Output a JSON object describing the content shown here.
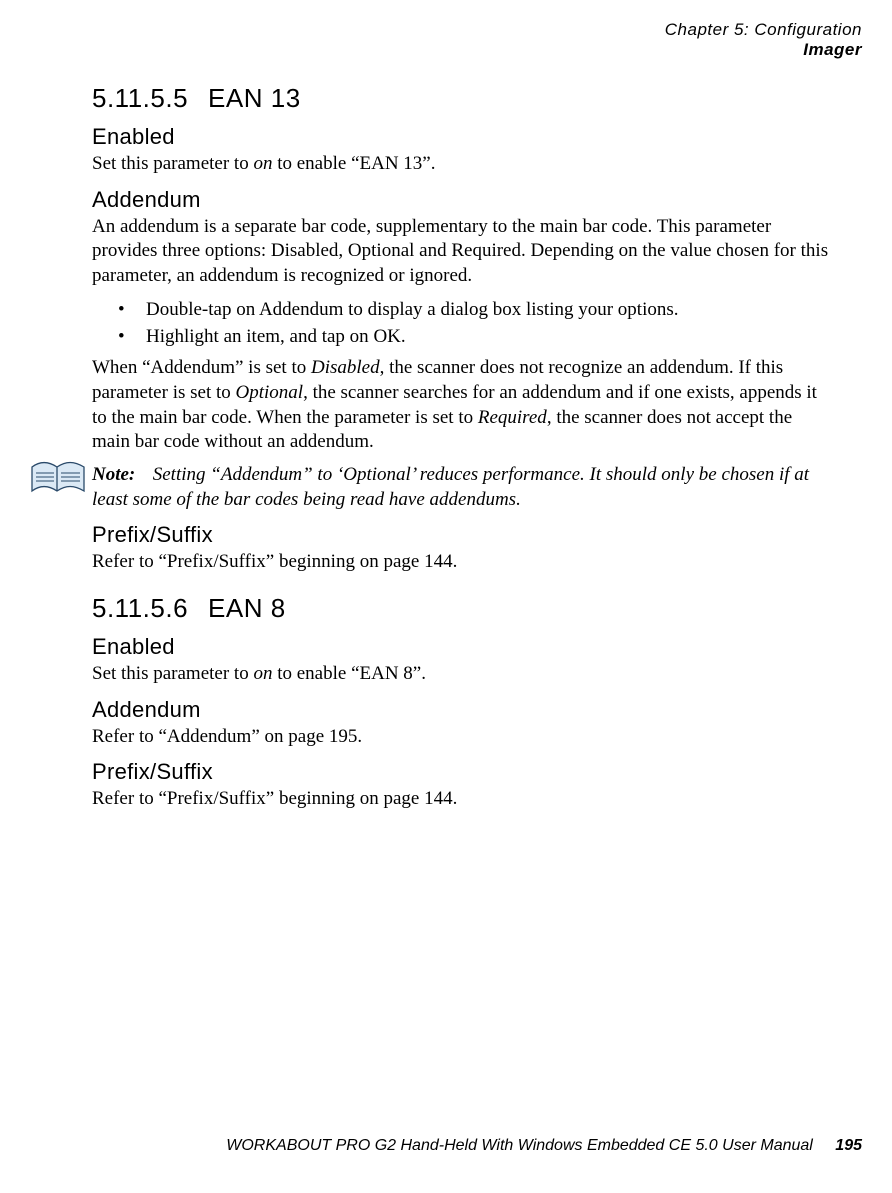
{
  "header": {
    "line1": "Chapter 5: Configuration",
    "line2": "Imager"
  },
  "sections": {
    "s1": {
      "number": "5.11.5.5",
      "title": "EAN 13",
      "enabled": {
        "heading": "Enabled",
        "pre": "Set this parameter to ",
        "em": "on",
        "post": " to enable “EAN 13”."
      },
      "addendum": {
        "heading": "Addendum",
        "para1": "An addendum is a separate bar code, supplementary to the main bar code. This parameter provides three options: Disabled, Optional and Required. Depending on the value chosen for this parameter, an addendum is recognized or ignored.",
        "bullet1_pre": "Double-tap on ",
        "bullet1_bold": "Addendum",
        "bullet1_post": " to display a dialog box listing your options.",
        "bullet2_pre": "Highlight an item, and tap on ",
        "bullet2_bold": "OK",
        "bullet2_post": ".",
        "para2_a": "When “Addendum” is set to ",
        "para2_opt1": "Disabled",
        "para2_b": ", the scanner does not recognize an addendum. If this parameter is set to ",
        "para2_opt2": "Optional",
        "para2_c": ", the scanner searches for an addendum and if one exists, appends it to the main bar code. When the parameter is set to ",
        "para2_opt3": "Required",
        "para2_d": ", the scanner does not accept the main bar code without an addendum."
      },
      "note": {
        "label": "Note:",
        "text": "Setting “Addendum” to ‘Optional’ reduces performance. It should only be chosen if at least some of the bar codes being read have addendums."
      },
      "prefix": {
        "heading": "Prefix/Suffix",
        "text": "Refer to “Prefix/Suffix” beginning on page 144."
      }
    },
    "s2": {
      "number": "5.11.5.6",
      "title": "EAN 8",
      "enabled": {
        "heading": "Enabled",
        "pre": "Set this parameter to ",
        "em": "on",
        "post": " to enable “EAN 8”."
      },
      "addendum": {
        "heading": "Addendum",
        "text": "Refer to “Addendum” on page 195."
      },
      "prefix": {
        "heading": "Prefix/Suffix",
        "text": "Refer to “Prefix/Suffix” beginning on page 144."
      }
    }
  },
  "footer": {
    "text": "WORKABOUT PRO G2 Hand-Held With Windows Embedded CE 5.0 User Manual",
    "page": "195"
  }
}
